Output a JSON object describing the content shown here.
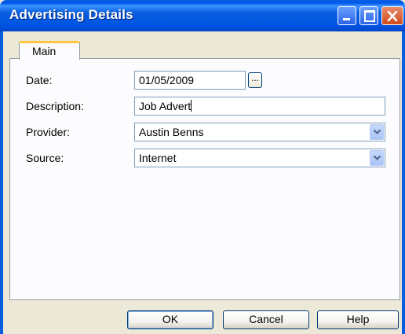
{
  "window": {
    "title": "Advertising Details"
  },
  "tabs": [
    {
      "label": "Main",
      "selected": true
    }
  ],
  "form": {
    "date_label": "Date:",
    "date_value": "01/05/2009",
    "date_button_label": "...",
    "description_label": "Description:",
    "description_value": "Job Advert",
    "provider_label": "Provider:",
    "provider_value": "Austin Benns",
    "source_label": "Source:",
    "source_value": "Internet"
  },
  "buttons": {
    "ok": "OK",
    "cancel": "Cancel",
    "help": "Help"
  },
  "colors": {
    "titlebar": "#0054e3",
    "tab_highlight": "#ffc83c",
    "field_border": "#7f9db9",
    "panel_bg": "#fcfcfe",
    "dialog_bg": "#ece9d8",
    "close_button": "#d24a1a"
  },
  "icons": {
    "minimize": "minimize-icon",
    "maximize": "maximize-icon",
    "close": "close-icon",
    "dropdown": "chevron-down-icon"
  }
}
